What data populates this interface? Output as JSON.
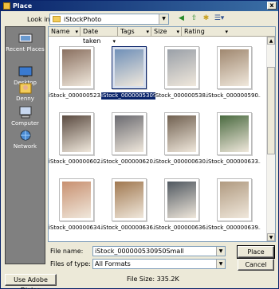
{
  "window": {
    "title": "Place",
    "close_glyph": "x"
  },
  "toolbar": {
    "lookin_label": "Look in:",
    "lookin_value": "iStockPhoto",
    "buttons": [
      {
        "name": "back",
        "glyph": "◀"
      },
      {
        "name": "up-folder",
        "glyph": "⇧"
      },
      {
        "name": "new-folder",
        "glyph": "✱"
      },
      {
        "name": "views-menu",
        "glyph": "☰▾"
      }
    ]
  },
  "places": [
    {
      "label": "Recent Places",
      "icon": "recent-places-icon"
    },
    {
      "label": "Desktop",
      "icon": "desktop-icon"
    },
    {
      "label": "Denny",
      "icon": "user-folder-icon"
    },
    {
      "label": "Computer",
      "icon": "computer-icon"
    },
    {
      "label": "Network",
      "icon": "network-icon"
    }
  ],
  "columns": [
    "Name",
    "Date taken",
    "Tags",
    "Size",
    "Rating"
  ],
  "files": [
    {
      "name": "iStock_000000523...",
      "selected": false,
      "color": "#8a7060"
    },
    {
      "name": "iStock_000000530950Small",
      "selected": true,
      "color": "#7090b8"
    },
    {
      "name": "iStock_000000538...",
      "selected": false,
      "color": "#9aa0a8"
    },
    {
      "name": "iStock_000000590...",
      "selected": false,
      "color": "#a08870"
    },
    {
      "name": "iStock_000000602...",
      "selected": false,
      "color": "#5a4a40"
    },
    {
      "name": "iStock_000000620...",
      "selected": false,
      "color": "#6a6a70"
    },
    {
      "name": "iStock_000000630...",
      "selected": false,
      "color": "#706050"
    },
    {
      "name": "iStock_000000633...",
      "selected": false,
      "color": "#4a6a40"
    },
    {
      "name": "iStock_000000634...",
      "selected": false,
      "color": "#c89070"
    },
    {
      "name": "iStock_000000636...",
      "selected": false,
      "color": "#a07850"
    },
    {
      "name": "iStock_000000636...",
      "selected": false,
      "color": "#505860"
    },
    {
      "name": "iStock_000000639...",
      "selected": false,
      "color": "#b09a80"
    }
  ],
  "bottom": {
    "filename_label": "File name:",
    "filename_value": "iStock_000000530950Small",
    "filetype_label": "Files of type:",
    "filetype_value": "All Formats",
    "place_button": "Place",
    "cancel_button": "Cancel",
    "adobe_dialog_button": "Use Adobe Dialog",
    "file_size": "File Size: 335.2K"
  }
}
